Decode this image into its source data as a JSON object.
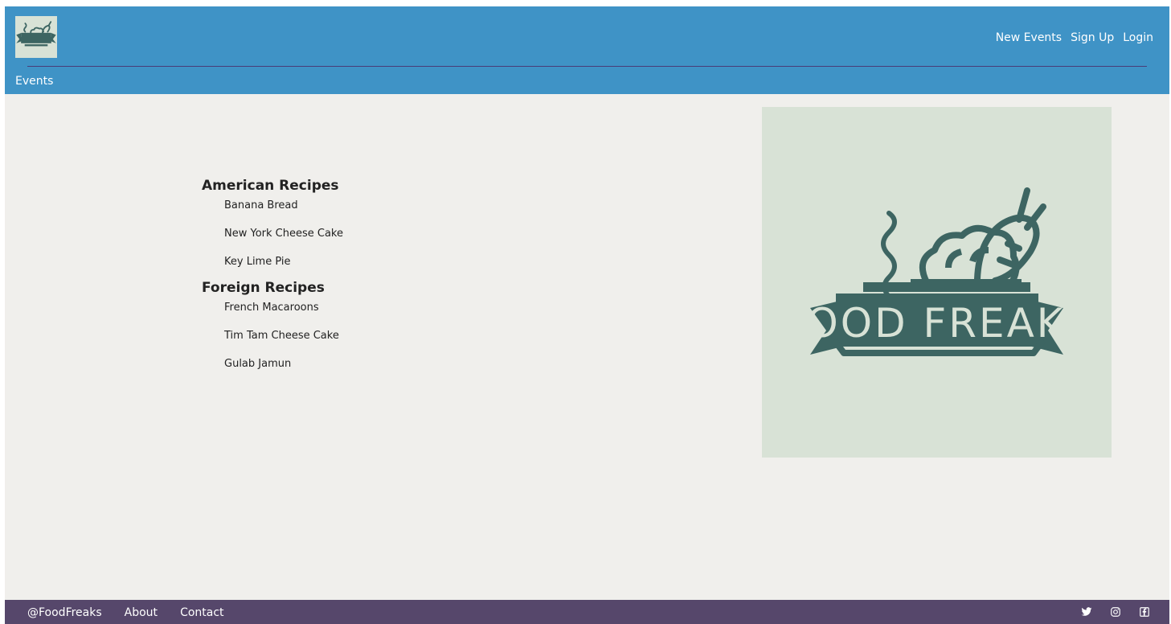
{
  "brand": {
    "logo_text": "FOOD FREAKS",
    "logo_color": "#3d6562",
    "panel_color": "#d8e2d6"
  },
  "header": {
    "nav": {
      "new_events": "New Events",
      "sign_up": "Sign Up",
      "login": "Login"
    },
    "sub_nav": {
      "events": "Events"
    }
  },
  "recipes": {
    "american": {
      "title": "American Recipes",
      "items": [
        "Banana Bread",
        "New York Cheese Cake",
        "Key Lime Pie"
      ]
    },
    "foreign": {
      "title": "Foreign Recipes",
      "items": [
        "French Macaroons",
        "Tim Tam Cheese Cake",
        "Gulab Jamun"
      ]
    }
  },
  "footer": {
    "handle": "@FoodFreaks",
    "about": "About",
    "contact": "Contact",
    "social_icons": [
      "twitter-icon",
      "instagram-icon",
      "facebook-icon"
    ]
  },
  "colors": {
    "header_bg": "#3f93c6",
    "footer_bg": "#56476b",
    "page_bg": "#f0efec"
  }
}
